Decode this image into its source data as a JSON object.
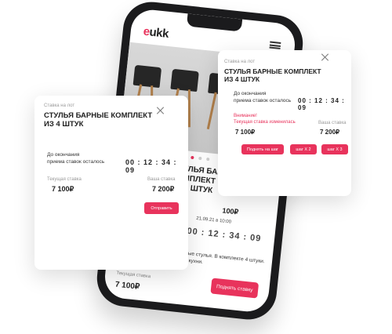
{
  "phone": {
    "logo_prefix": "e",
    "logo_suffix": "ukk",
    "title_line1": "СТУЛЬЯ БАРНЫЕ КОМПЛЕКТ",
    "title_line2": "ИЗ 4 ШТУК",
    "price_right": "100₽",
    "date": "21.09.21 в 10:00",
    "timer": "00 : 12 : 34 : 09",
    "description": "Высокие барные стулья. В комплекте 4 штуки. Подойдут для кухни.",
    "current_bid_label": "Текущая ставка",
    "current_bid_value": "7 100₽",
    "bid_button": "Поднять ставку",
    "slider_dots": 3,
    "active_dot": 0
  },
  "card_left": {
    "tag": "Ставка на лот",
    "title_line1": "СТУЛЬЯ БАРНЫЕ КОМПЛЕКТ",
    "title_line2": "ИЗ 4 ШТУК",
    "time_left_line1": "До окончания",
    "time_left_line2": "приема ставок осталось",
    "timer": "00 : 12 : 34 : 09",
    "current_bid_label": "Текущая ставка",
    "current_bid_value": "7 100₽",
    "your_bid_label": "Ваша ставка",
    "your_bid_value": "7 200₽",
    "submit_button": "Отправить"
  },
  "card_right": {
    "tag": "Ставка на лот",
    "title_line1": "СТУЛЬЯ БАРНЫЕ КОМПЛЕКТ",
    "title_line2": "ИЗ 4 ШТУК",
    "time_left_line1": "До окончания",
    "time_left_line2": "приема ставок осталось",
    "timer": "00 : 12 : 34 : 09",
    "warning_line1": "Внимание!",
    "warning_line2": "Текущая ставка изменилась",
    "current_bid_value": "7 100₽",
    "your_bid_label": "Ваша ставка",
    "your_bid_value": "7 200₽",
    "raise_button": "Поднять на  шаг",
    "step_x2_button": "шаг Х 2",
    "step_x3_button": "шаг Х 3"
  },
  "colors": {
    "accent": "#e8335c",
    "phone_body": "#1b1b1d"
  }
}
